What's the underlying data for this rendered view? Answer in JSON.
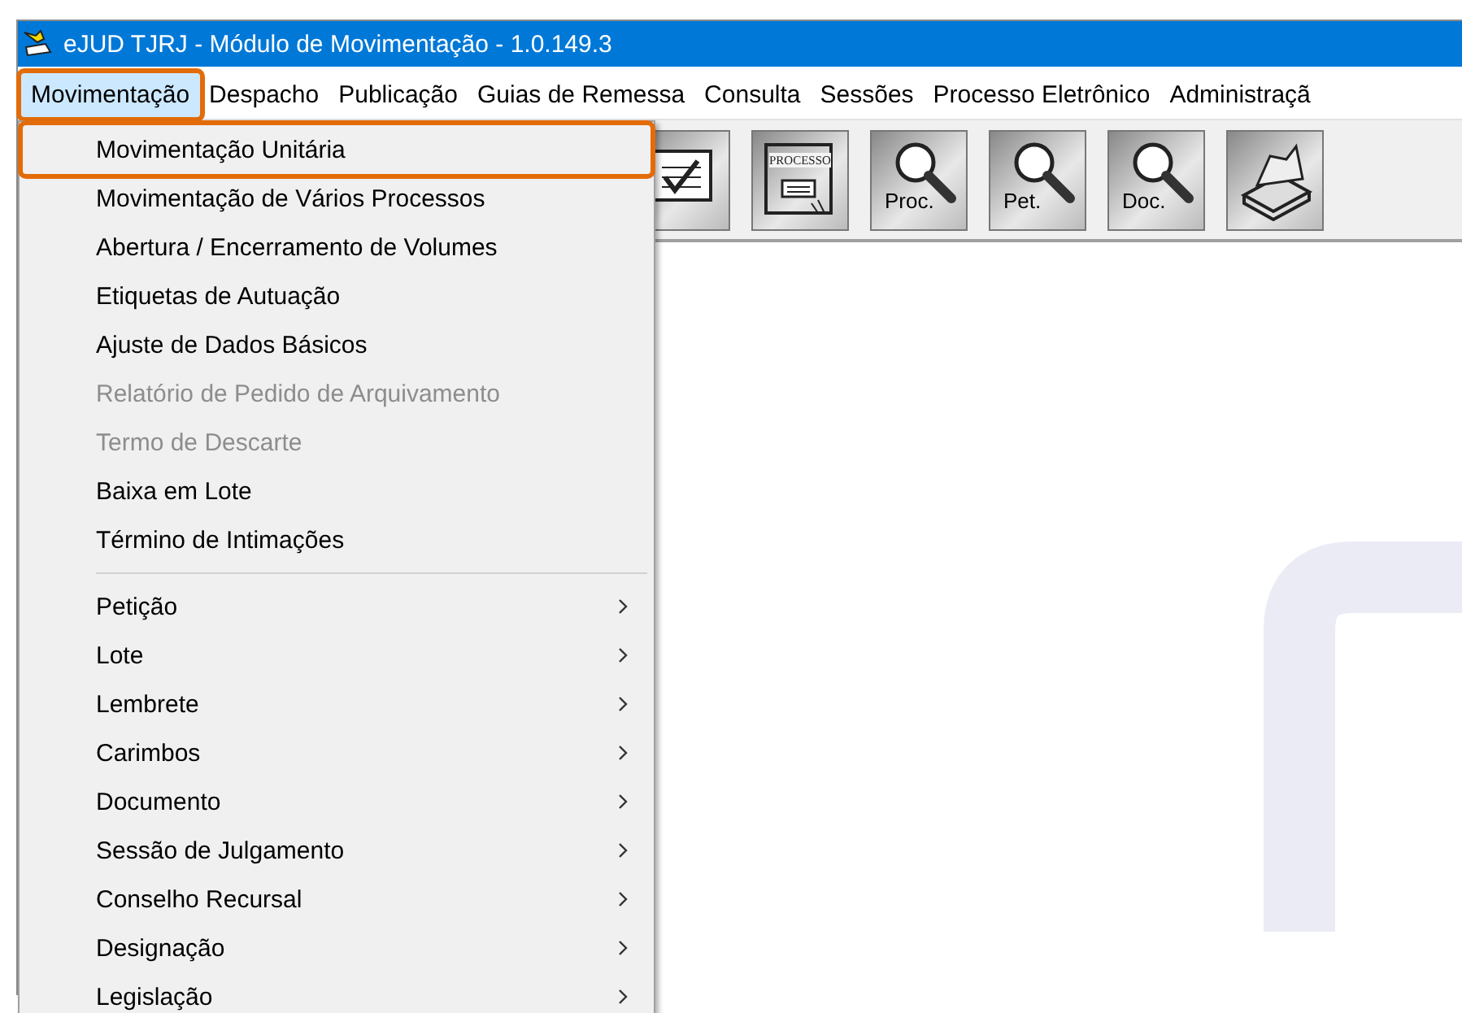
{
  "window": {
    "title": "eJUD TJRJ - Módulo de Movimentação - 1.0.149.3"
  },
  "menu_bar": [
    {
      "label": "Movimentação",
      "selected": true,
      "highlighted": true
    },
    {
      "label": "Despacho",
      "selected": false,
      "highlighted": false
    },
    {
      "label": "Publicação",
      "selected": false,
      "highlighted": false
    },
    {
      "label": "Guias de Remessa",
      "selected": false,
      "highlighted": false
    },
    {
      "label": "Consulta",
      "selected": false,
      "highlighted": false
    },
    {
      "label": "Sessões",
      "selected": false,
      "highlighted": false
    },
    {
      "label": "Processo Eletrônico",
      "selected": false,
      "highlighted": false
    },
    {
      "label": "Administraçã",
      "selected": false,
      "highlighted": false
    }
  ],
  "toolbar": [
    {
      "kind": "form-check"
    },
    {
      "kind": "form",
      "label": "PROCESSO"
    },
    {
      "kind": "search",
      "label": "Proc."
    },
    {
      "kind": "search",
      "label": "Pet."
    },
    {
      "kind": "search",
      "label": "Doc."
    },
    {
      "kind": "printer"
    }
  ],
  "dropdown": [
    {
      "kind": "item",
      "label": "Movimentação Unitária",
      "disabled": false,
      "highlighted": true
    },
    {
      "kind": "item",
      "label": "Movimentação de Vários Processos",
      "disabled": false,
      "highlighted": false
    },
    {
      "kind": "item",
      "label": "Abertura / Encerramento de Volumes",
      "disabled": false,
      "highlighted": false
    },
    {
      "kind": "item",
      "label": "Etiquetas de Autuação",
      "disabled": false,
      "highlighted": false
    },
    {
      "kind": "item",
      "label": "Ajuste de Dados Básicos",
      "disabled": false,
      "highlighted": false
    },
    {
      "kind": "item",
      "label": "Relatório de Pedido de Arquivamento",
      "disabled": true,
      "highlighted": false
    },
    {
      "kind": "item",
      "label": "Termo de Descarte",
      "disabled": true,
      "highlighted": false
    },
    {
      "kind": "item",
      "label": "Baixa em Lote",
      "disabled": false,
      "highlighted": false
    },
    {
      "kind": "item",
      "label": "Término de Intimações",
      "disabled": false,
      "highlighted": false
    },
    {
      "kind": "separator"
    },
    {
      "kind": "submenu",
      "label": "Petição",
      "disabled": false,
      "highlighted": false
    },
    {
      "kind": "submenu",
      "label": "Lote",
      "disabled": false,
      "highlighted": false
    },
    {
      "kind": "submenu",
      "label": "Lembrete",
      "disabled": false,
      "highlighted": false
    },
    {
      "kind": "submenu",
      "label": "Carimbos",
      "disabled": false,
      "highlighted": false
    },
    {
      "kind": "submenu",
      "label": "Documento",
      "disabled": false,
      "highlighted": false
    },
    {
      "kind": "submenu",
      "label": "Sessão de Julgamento",
      "disabled": false,
      "highlighted": false
    },
    {
      "kind": "submenu",
      "label": "Conselho Recursal",
      "disabled": false,
      "highlighted": false
    },
    {
      "kind": "submenu",
      "label": "Designação",
      "disabled": false,
      "highlighted": false
    },
    {
      "kind": "submenu",
      "label": "Legislação",
      "disabled": false,
      "highlighted": false
    }
  ]
}
